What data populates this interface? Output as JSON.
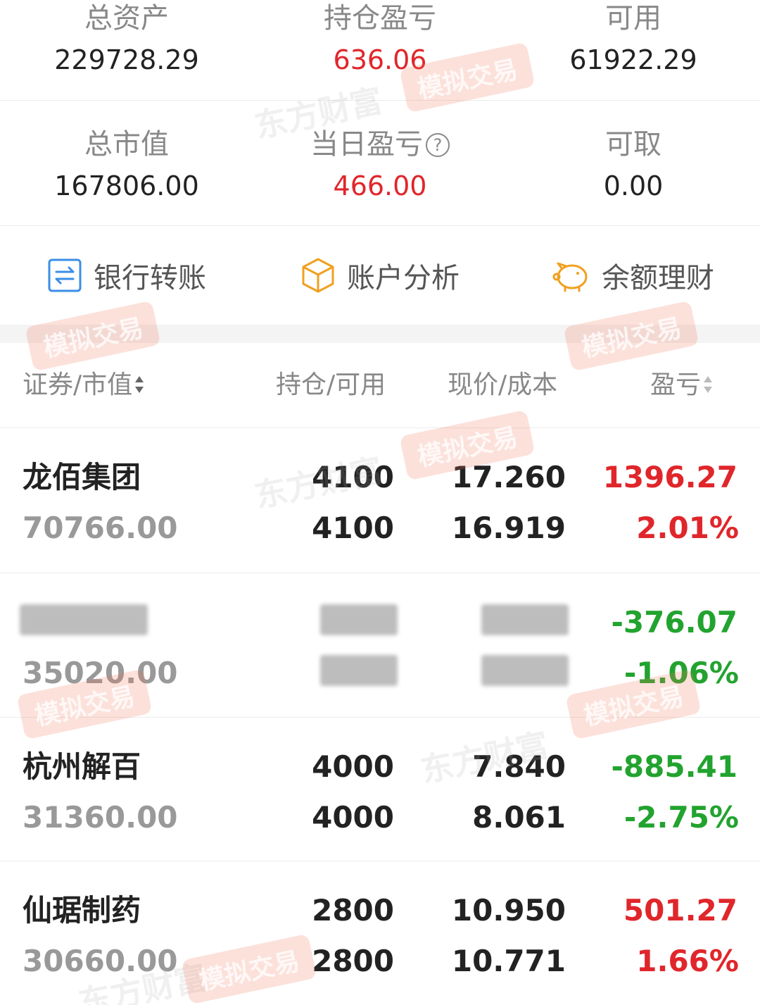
{
  "summary": {
    "total_assets_label": "总资产",
    "total_assets_value": "229728.29",
    "position_pl_label": "持仓盈亏",
    "position_pl_value": "636.06",
    "available_label": "可用",
    "available_value": "61922.29",
    "market_value_label": "总市值",
    "market_value_value": "167806.00",
    "daily_pl_label": "当日盈亏",
    "daily_pl_value": "466.00",
    "withdrawable_label": "可取",
    "withdrawable_value": "0.00"
  },
  "actions": [
    {
      "label": "银行转账",
      "icon": "transfer-icon",
      "color": "#3a8ee6"
    },
    {
      "label": "账户分析",
      "icon": "box-icon",
      "color": "#f0a020"
    },
    {
      "label": "余额理财",
      "icon": "piggy-bank-icon",
      "color": "#f0a020"
    }
  ],
  "table": {
    "headers": {
      "security": "证券/市值",
      "holding": "持仓/可用",
      "price": "现价/成本",
      "pl": "盈亏"
    },
    "rows": [
      {
        "name": "龙佰集团",
        "market_value": "70766.00",
        "holding": "4100",
        "available": "4100",
        "price": "17.260",
        "cost": "16.919",
        "pl": "1396.27",
        "pl_pct": "2.01%",
        "status": "gain"
      },
      {
        "name": "",
        "market_value": "35020.00",
        "holding": "",
        "available": "",
        "price": "",
        "cost": "",
        "pl": "-376.07",
        "pl_pct": "-1.06%",
        "status": "loss"
      },
      {
        "name": "杭州解百",
        "market_value": "31360.00",
        "holding": "4000",
        "available": "4000",
        "price": "7.840",
        "cost": "8.061",
        "pl": "-885.41",
        "pl_pct": "-2.75%",
        "status": "loss"
      },
      {
        "name": "仙琚制药",
        "market_value": "30660.00",
        "holding": "2800",
        "available": "2800",
        "price": "10.950",
        "cost": "10.771",
        "pl": "501.27",
        "pl_pct": "1.66%",
        "status": "gain"
      }
    ]
  },
  "watermark": {
    "brand": "东方财富",
    "badge": "模拟交易"
  },
  "colors": {
    "gain": "#e0262b",
    "loss": "#22a32f",
    "label": "#888888"
  }
}
